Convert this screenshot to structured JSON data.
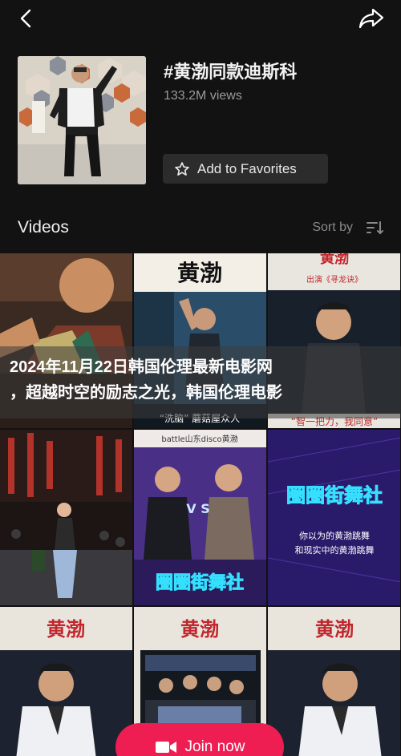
{
  "top_bar": {
    "back_icon": "chevron-left-icon",
    "share_icon": "share-arrow-icon"
  },
  "sound": {
    "title": "#黄渤同款迪斯科",
    "views": "133.2M views",
    "favorite_label": "Add to Favorites",
    "favorite_icon": "star-icon"
  },
  "videos_section": {
    "title": "Videos",
    "sort_label": "Sort by",
    "sort_icon": "sort-lines-icon"
  },
  "tiles": [
    {
      "caption": ""
    },
    {
      "caption": "黄渤",
      "sub": "“洗脑” 蘑菇屋众人"
    },
    {
      "caption": "黄渤",
      "sub": "出演《寻龙诀》",
      "sub2": "“智一把力，我同意”"
    },
    {
      "caption": ""
    },
    {
      "caption": "battle山东disco黄渤",
      "vs": "V S"
    },
    {
      "caption": "圈圈街舞社",
      "sub": "你以为的黄渤跳舞",
      "sub2": "和现实中的黄渤跳舞"
    },
    {
      "caption": "黄渤"
    },
    {
      "caption": "黄渤"
    },
    {
      "caption": "黄渤"
    }
  ],
  "overlay": {
    "line1": "2024年11月22日韩国伦理最新电影网",
    "line2": "，超越时空的励志之光，韩国伦理电影"
  },
  "join_button": {
    "label": "Join now",
    "icon": "video-camera-icon",
    "color": "#ee1d52"
  }
}
